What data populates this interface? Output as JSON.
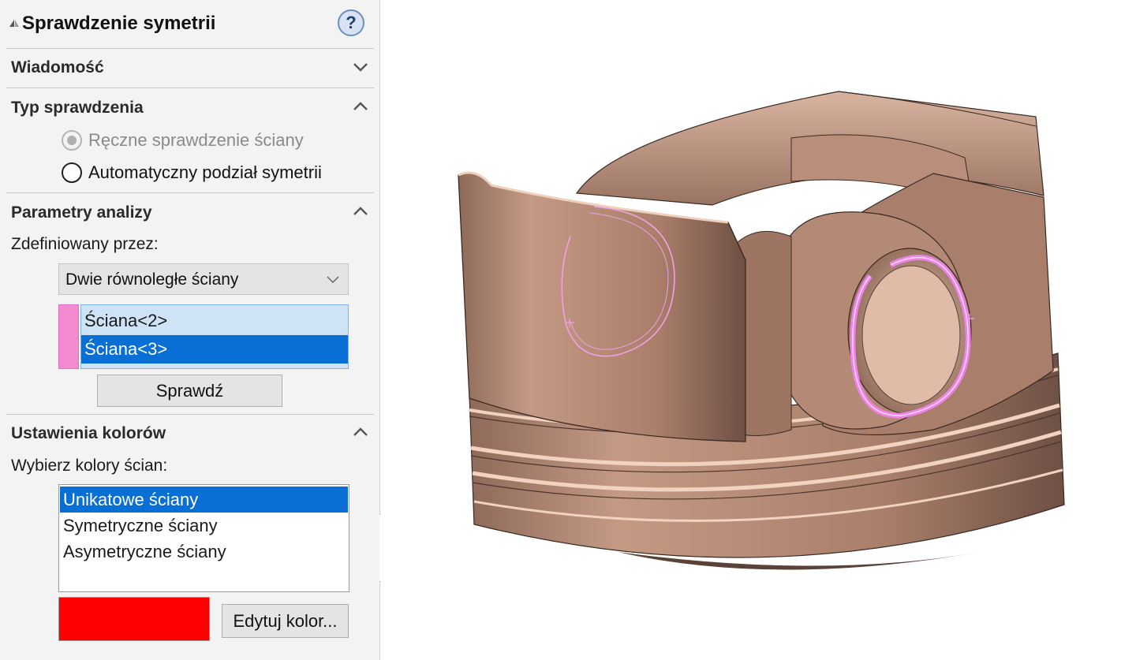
{
  "property_manager": {
    "title": "Sprawdzenie symetrii",
    "help_icon": "question-mark-icon",
    "help_label": "?",
    "sections": {
      "message": {
        "title": "Wiadomość",
        "state": "collapsed"
      },
      "check_type": {
        "title": "Typ sprawdzenia",
        "state": "expanded",
        "options": [
          {
            "label": "Ręczne sprawdzenie ściany",
            "selected": true,
            "disabled": true
          },
          {
            "label": "Automatyczny podział symetrii",
            "selected": false,
            "disabled": false
          }
        ]
      },
      "analysis": {
        "title": "Parametry analizy",
        "state": "expanded",
        "defined_by_label": "Zdefiniowany przez:",
        "defined_by_value": "Dwie równoległe ściany",
        "faces": [
          "Ściana<2>",
          "Ściana<3>"
        ],
        "selected_face_index": 1,
        "face_marker_color": "#f28ad0",
        "check_button": "Sprawdź"
      },
      "colors": {
        "title": "Ustawienia kolorów",
        "state": "expanded",
        "choose_label": "Wybierz kolory ścian:",
        "face_types": [
          "Unikatowe ściany",
          "Symetryczne ściany",
          "Asymetryczne ściany"
        ],
        "selected_type_index": 0,
        "current_color": "#ff0000",
        "edit_button": "Edytuj kolor..."
      }
    }
  },
  "viewport": {
    "model": "piston",
    "model_color": "#c49a85",
    "highlight_color": "#ee82e6"
  }
}
